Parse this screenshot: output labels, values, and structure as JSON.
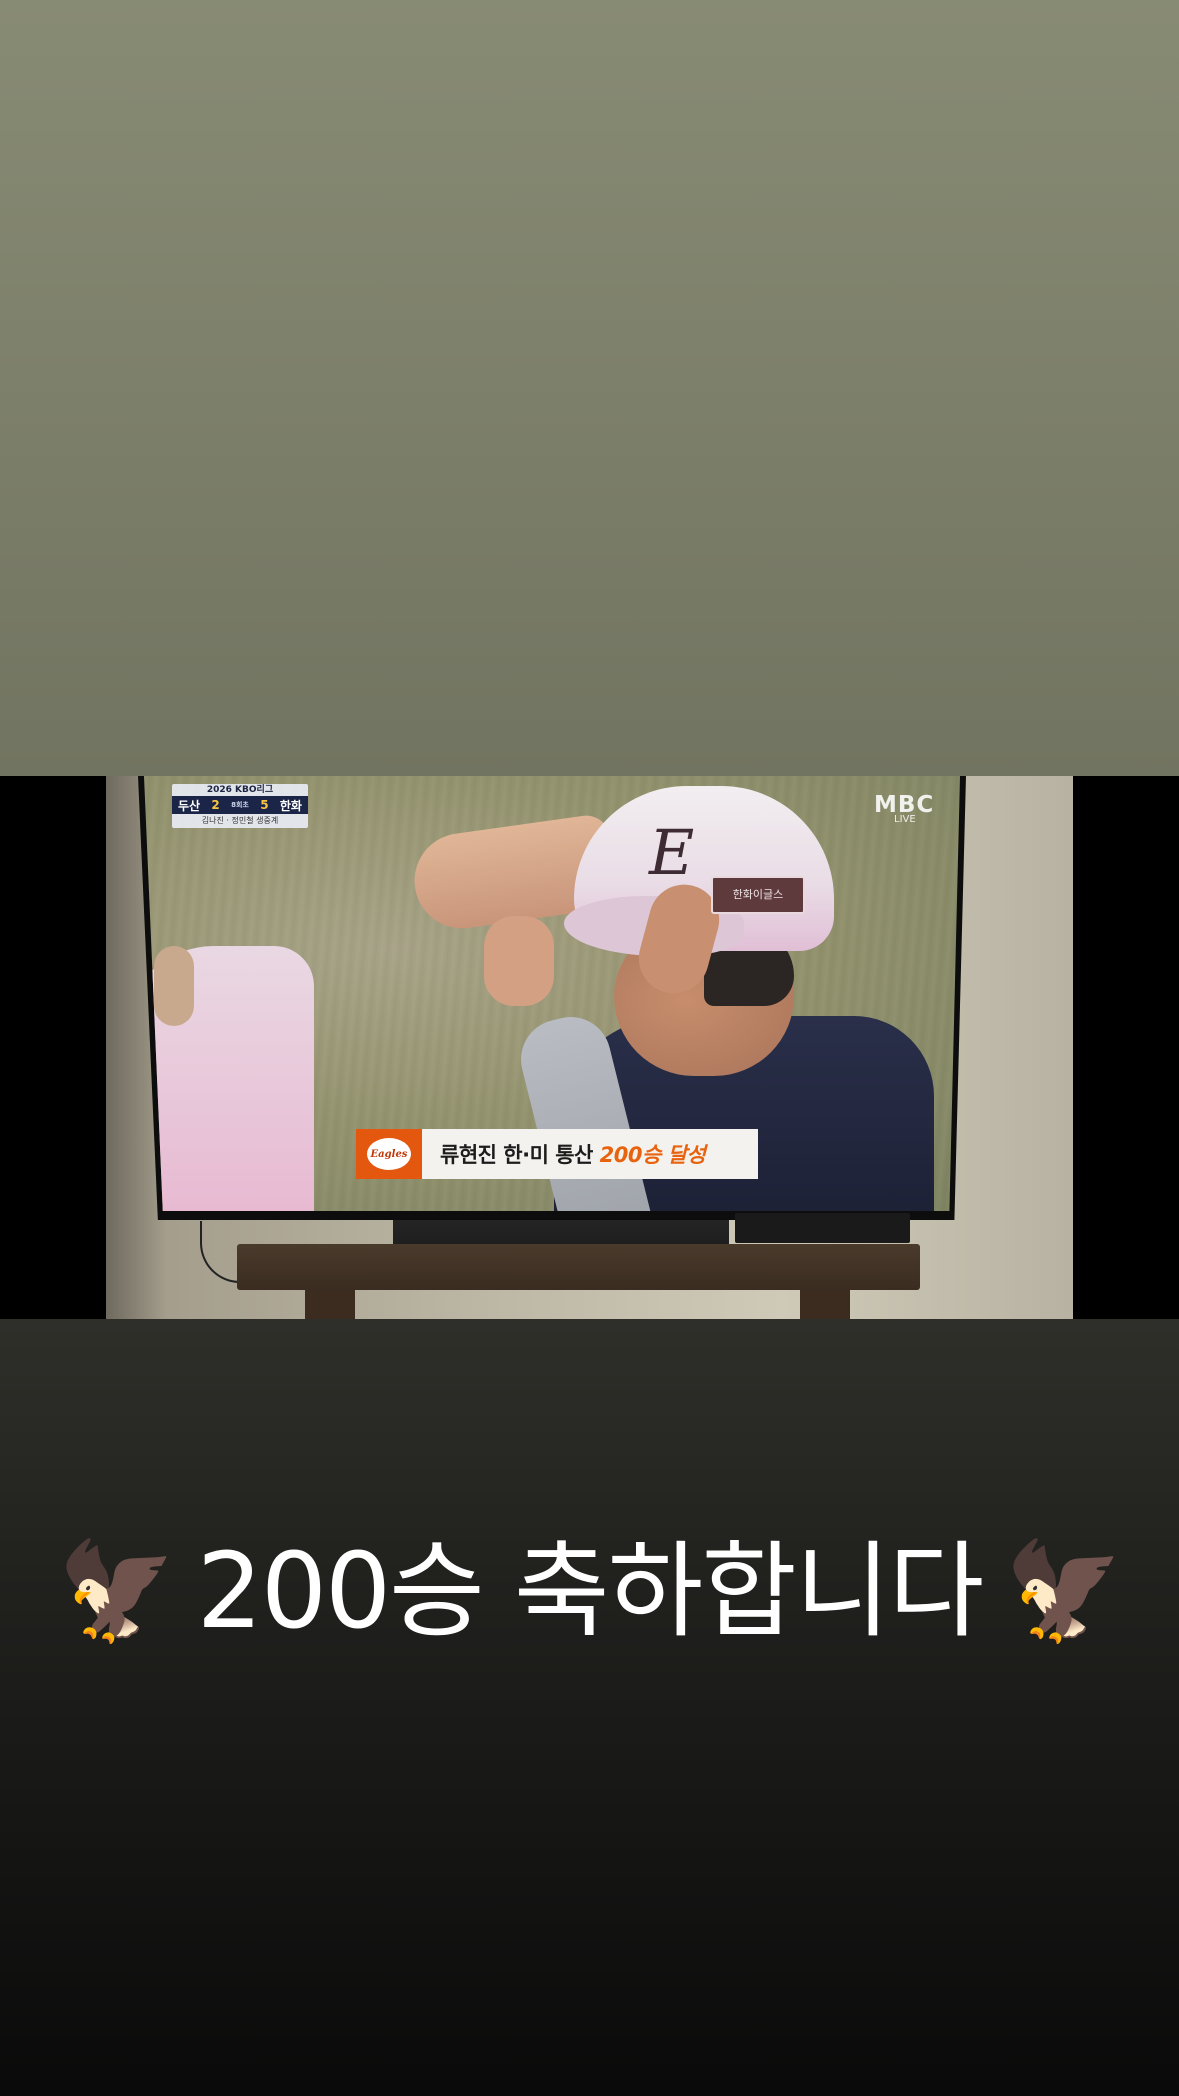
{
  "broadcast": {
    "league": "2026 KBO리그",
    "away_team": "두산",
    "away_score": "2",
    "inning": "8회초",
    "home_score": "5",
    "home_team": "한화",
    "commentators": "김나진 · 정민철 생중계",
    "network": "MBC",
    "network_status": "LIVE",
    "cap_patch": "한화이글스",
    "caption_logo": "Eagles",
    "caption_main": "류현진 한·미 통산 ",
    "caption_highlight": "200승 달성"
  },
  "story": {
    "eagle_left": "🦅",
    "message": "200승 축하합니다",
    "eagle_right": "🦅"
  }
}
